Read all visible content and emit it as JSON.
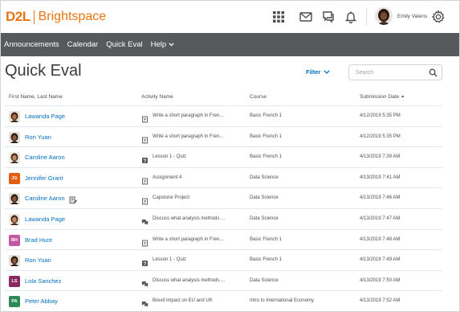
{
  "header": {
    "logo_mark": "D2L",
    "logo_text": "Brightspace",
    "user_name": "Emily Valens",
    "brand_color": "#e87511",
    "icons": [
      "apps-grid-icon",
      "mail-icon",
      "chat-icon",
      "bell-icon",
      "gear-icon"
    ]
  },
  "nav": {
    "items": [
      {
        "label": "Announcements"
      },
      {
        "label": "Calendar"
      },
      {
        "label": "Quick Eval"
      },
      {
        "label": "Help"
      }
    ],
    "bg_color": "#565a5c"
  },
  "page": {
    "title": "Quick Eval",
    "filter_label": "Filter",
    "search_placeholder": "Search"
  },
  "table": {
    "columns": [
      "First Name, Last Name",
      "Activity Name",
      "Course",
      "Submission Date"
    ],
    "sorted_column": "Submission Date",
    "rows": [
      {
        "name": "Lawanda Page",
        "avatar": "photo",
        "activity_icon": "assignment-icon",
        "activity": "Write a short paragraph in Fren...",
        "course": "Basic French 1",
        "date": "4/12/2019 5:35 PM"
      },
      {
        "name": "Ron Yuan",
        "avatar": "photo",
        "activity_icon": "assignment-icon",
        "activity": "Write a short paragraph in Fren...",
        "course": "Basic French 1",
        "date": "4/12/2019 5:35 PM"
      },
      {
        "name": "Caroline Aaron",
        "avatar": "photo",
        "activity_icon": "quiz-icon",
        "activity": "Lesson 1 - Quiz",
        "course": "Basic French 1",
        "date": "4/13/2019 7:39 AM"
      },
      {
        "name": "Jennifer Grant",
        "avatar": "JG",
        "avatar_color": "#e25e12",
        "activity_icon": "assignment-icon",
        "activity": "Assignment 4",
        "course": "Data Science",
        "date": "4/13/2019 7:41 AM"
      },
      {
        "name": "Caroline Aaron",
        "avatar": "photo",
        "has_note": true,
        "activity_icon": "assignment-icon",
        "activity": "Capstone Project",
        "course": "Data Science",
        "date": "4/13/2019 7:46 AM"
      },
      {
        "name": "Lawanda Page",
        "avatar": "photo",
        "activity_icon": "discussion-icon",
        "activity": "Discuss what analysis methods ...",
        "course": "Data Science",
        "date": "4/13/2019 7:47 AM"
      },
      {
        "name": "Brad Hunt",
        "avatar": "BH",
        "avatar_color": "#c058a3",
        "activity_icon": "assignment-icon",
        "activity": "Write a short paragraph in Fren...",
        "course": "Basic French 1",
        "date": "4/13/2019 7:48 AM"
      },
      {
        "name": "Ron Yuan",
        "avatar": "photo",
        "activity_icon": "quiz-icon",
        "activity": "Lesson 1 - Quiz",
        "course": "Basic French 1",
        "date": "4/13/2019 7:49 AM"
      },
      {
        "name": "Lola Sanchez",
        "avatar": "LS",
        "avatar_color": "#8a2a63",
        "activity_icon": "discussion-icon",
        "activity": "Discuss what analysis methods ...",
        "course": "Data Science",
        "date": "4/13/2019 7:50 AM"
      },
      {
        "name": "Peter Abbay",
        "avatar": "PA",
        "avatar_color": "#2e8b57",
        "activity_icon": "discussion-icon",
        "activity": "Brexit impact on EU and UK",
        "course": "Intro to International Economy",
        "date": "4/13/2019 7:52 AM"
      }
    ]
  },
  "colors": {
    "link": "#006fbf",
    "accent": "#e87511"
  }
}
